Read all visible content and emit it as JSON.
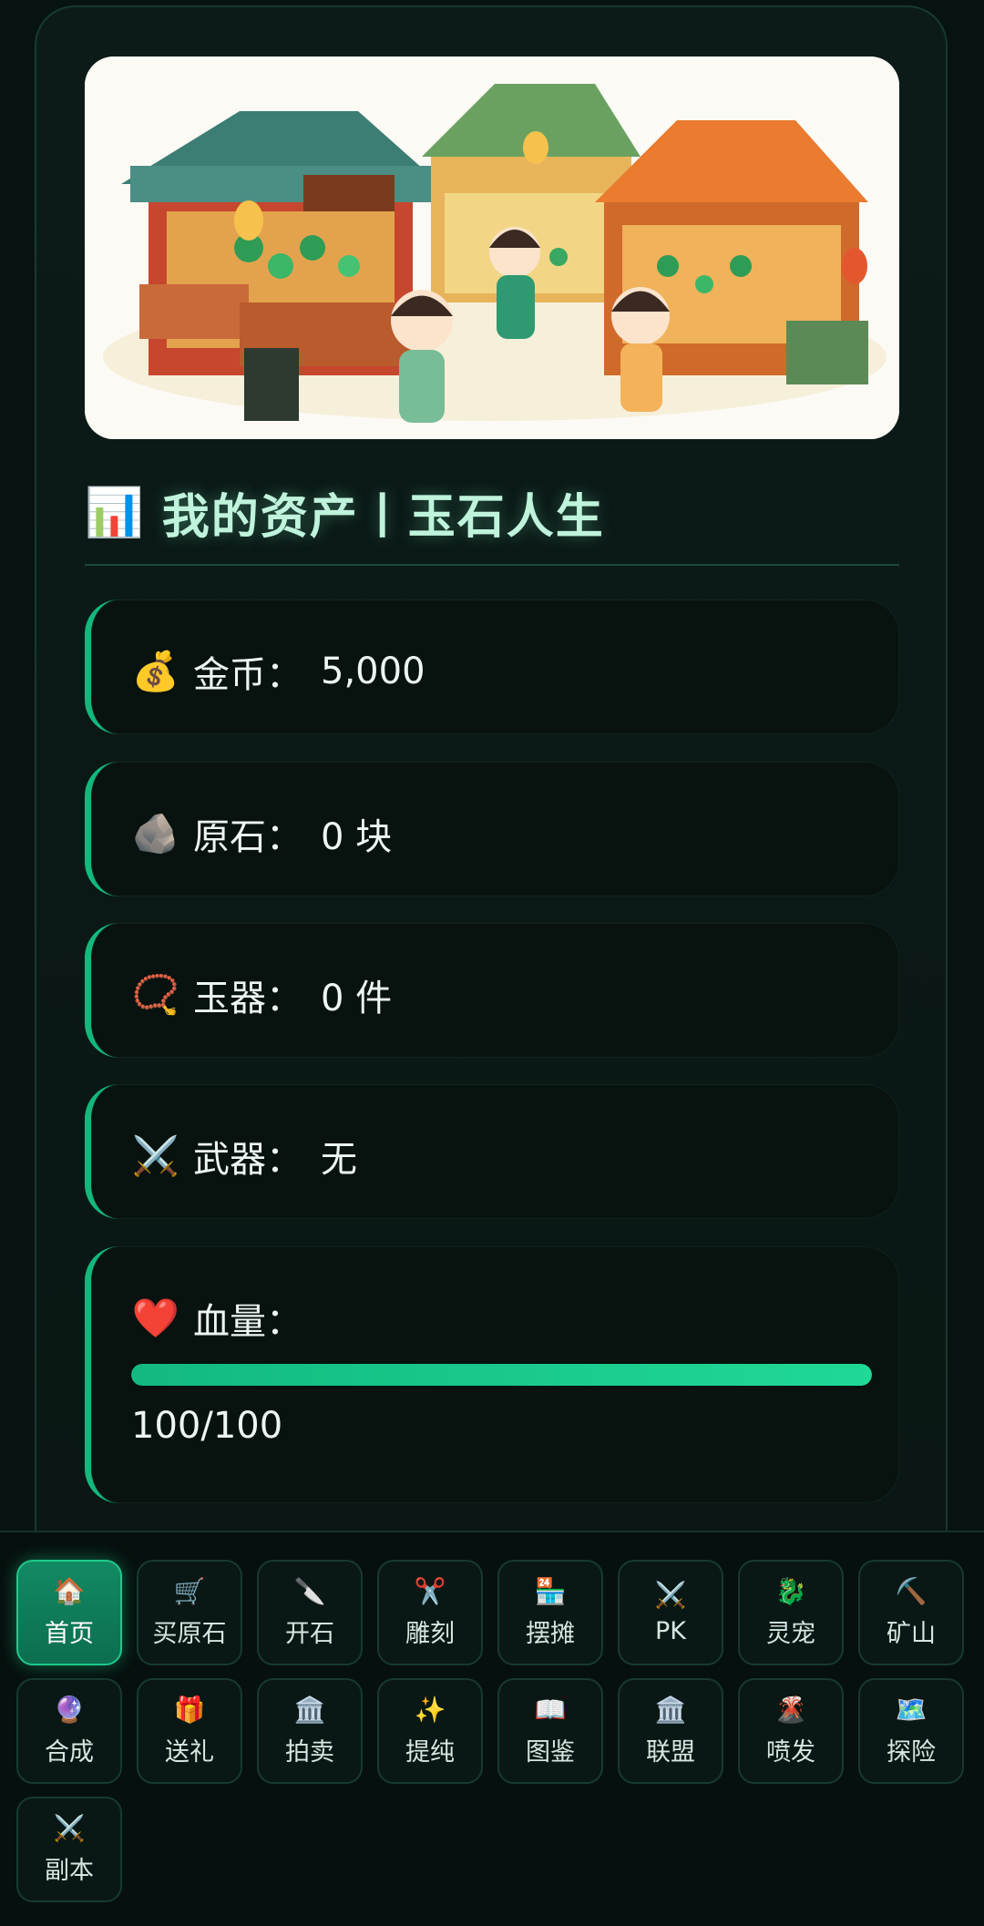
{
  "header": {
    "title_icon": "📊",
    "title": "我的资产丨玉石人生"
  },
  "stats": {
    "gold": {
      "icon": "💰",
      "label": "金币：",
      "value": "5,000"
    },
    "stone": {
      "icon": "🪨",
      "label": "原石：",
      "value": "0 块"
    },
    "jade": {
      "icon": "📿",
      "label": "玉器：",
      "value": "0 件"
    },
    "weapon": {
      "icon": "⚔️",
      "label": "武器：",
      "value": "无"
    },
    "hp": {
      "icon": "❤️",
      "label": "血量：",
      "text": "100/100",
      "current": 100,
      "max": 100,
      "fraction": 1.0
    }
  },
  "nav": {
    "items": [
      {
        "icon": "🏠",
        "label": "首页",
        "active": true
      },
      {
        "icon": "🛒",
        "label": "买原石"
      },
      {
        "icon": "🔪",
        "label": "开石"
      },
      {
        "icon": "✂️",
        "label": "雕刻"
      },
      {
        "icon": "🏪",
        "label": "摆摊"
      },
      {
        "icon": "⚔️",
        "label": "PK"
      },
      {
        "icon": "🐉",
        "label": "灵宠"
      },
      {
        "icon": "⛏️",
        "label": "矿山"
      },
      {
        "icon": "🔮",
        "label": "合成"
      },
      {
        "icon": "🎁",
        "label": "送礼"
      },
      {
        "icon": "🏛️",
        "label": "拍卖"
      },
      {
        "icon": "✨",
        "label": "提纯"
      },
      {
        "icon": "📖",
        "label": "图鉴"
      },
      {
        "icon": "🏛️",
        "label": "联盟"
      },
      {
        "icon": "🌋",
        "label": "喷发"
      },
      {
        "icon": "🗺️",
        "label": "探险"
      },
      {
        "icon": "⚔️",
        "label": "副本"
      }
    ]
  },
  "colors": {
    "accent": "#14b87c",
    "background": "#071311",
    "title": "#bff3dc"
  }
}
